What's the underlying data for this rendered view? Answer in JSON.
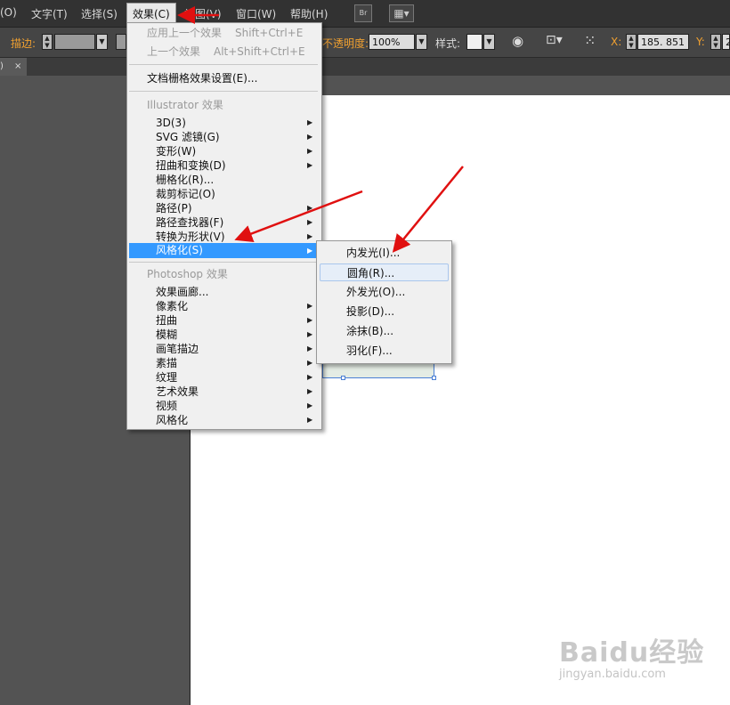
{
  "menubar": {
    "items": [
      "(O)",
      "文字(T)",
      "选择(S)",
      "效果(C)",
      "视图(V)",
      "窗口(W)",
      "帮助(H)"
    ],
    "br_label": "Br"
  },
  "control_bar": {
    "stroke_label": "描边:",
    "opacity_label": "不透明度:",
    "opacity_value": "100%",
    "style_label": "样式:",
    "x_label": "X:",
    "x_value": "185. 851",
    "y_label": "Y:",
    "y_value": "2"
  },
  "doc_tab": {
    "label": ")",
    "close": "×"
  },
  "effects_menu": {
    "items": [
      {
        "label": "应用上一个效果",
        "shortcut": "Shift+Ctrl+E"
      },
      {
        "label": "上一个效果",
        "shortcut": "Alt+Shift+Ctrl+E"
      },
      {
        "label": "文档栅格效果设置(E)..."
      },
      {
        "label": "Illustrator 效果"
      },
      {
        "label": "3D(3)"
      },
      {
        "label": "SVG 滤镜(G)"
      },
      {
        "label": "变形(W)"
      },
      {
        "label": "扭曲和变换(D)"
      },
      {
        "label": "栅格化(R)..."
      },
      {
        "label": "裁剪标记(O)"
      },
      {
        "label": "路径(P)"
      },
      {
        "label": "路径查找器(F)"
      },
      {
        "label": "转换为形状(V)"
      },
      {
        "label": "风格化(S)"
      },
      {
        "label": "Photoshop 效果"
      },
      {
        "label": "效果画廊..."
      },
      {
        "label": "像素化"
      },
      {
        "label": "扭曲"
      },
      {
        "label": "模糊"
      },
      {
        "label": "画笔描边"
      },
      {
        "label": "素描"
      },
      {
        "label": "纹理"
      },
      {
        "label": "艺术效果"
      },
      {
        "label": "视频"
      },
      {
        "label": "风格化"
      }
    ]
  },
  "stylize_submenu": {
    "items": [
      "内发光(I)...",
      "圆角(R)...",
      "外发光(O)...",
      "投影(D)...",
      "涂抹(B)...",
      "羽化(F)..."
    ]
  },
  "watermark": {
    "logo": "Baidu经验",
    "url": "jingyan.baidu.com"
  },
  "colors": {
    "highlight": "#3399ff",
    "annotation_arrow": "#e01010",
    "label_orange": "#f0a030"
  }
}
